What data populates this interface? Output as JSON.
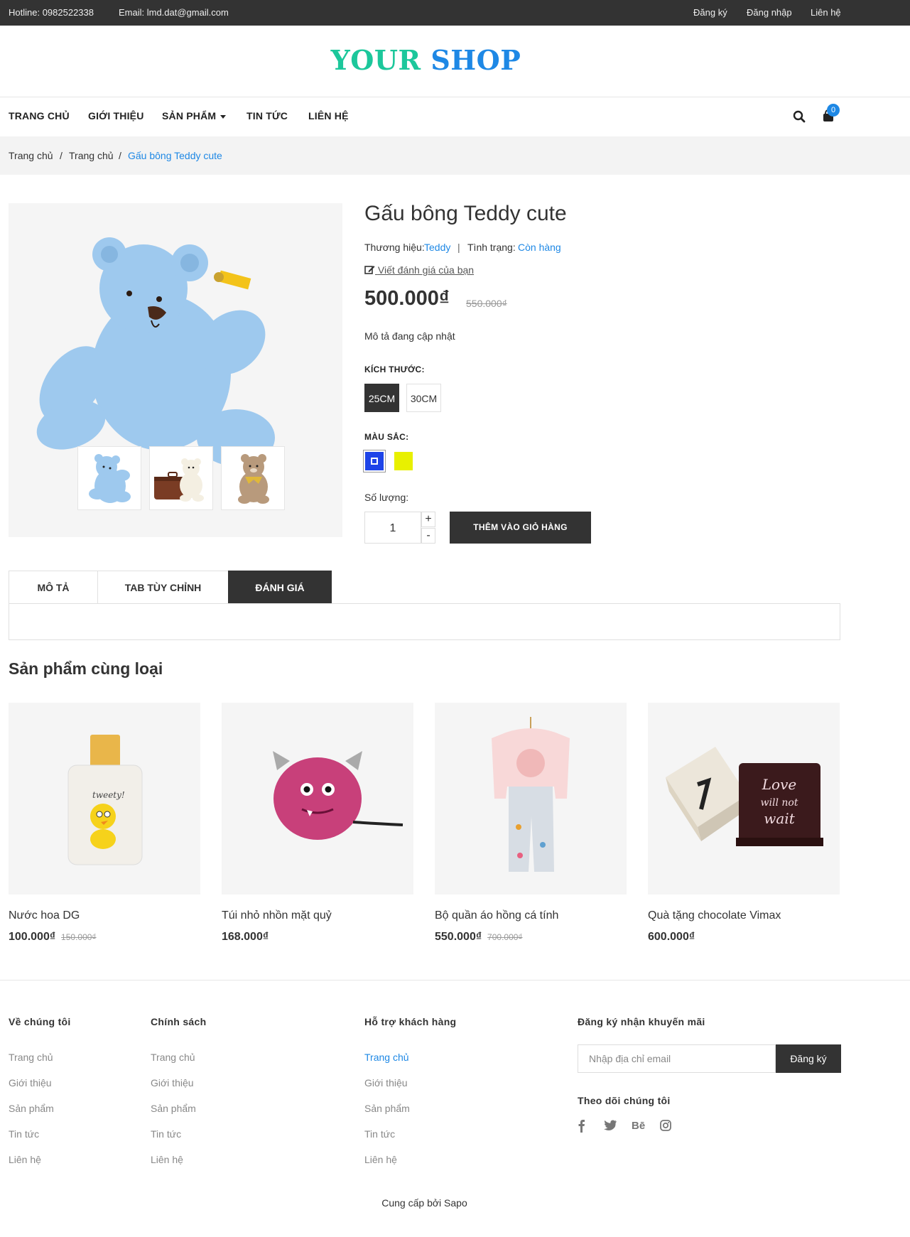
{
  "topbar": {
    "hotline": "Hotline: 0982522338",
    "email": "Email: lmd.dat@gmail.com",
    "register": "Đăng ký",
    "login": "Đăng nhập",
    "contact": "Liên hệ"
  },
  "logo": {
    "word1": "YOUR",
    "word2": "SHOP"
  },
  "nav": {
    "home": "TRANG CHỦ",
    "about": "GIỚI THIỆU",
    "products": "SẢN PHẨM",
    "news": "TIN TỨC",
    "contact": "LIÊN HỆ",
    "cart_count": "0"
  },
  "breadcrumb": [
    "Trang chủ",
    "Trang chủ",
    "Gấu bông Teddy cute"
  ],
  "product": {
    "title": "Gấu bông Teddy cute",
    "brand_label": "Thương hiệu:",
    "brand": "Teddy",
    "separator": "|",
    "status_label": "Tình trạng:",
    "status": "Còn hàng",
    "review_link": "Viết đánh giá của bạn",
    "price": "500.000₫",
    "old_price": "550.000₫",
    "description": "Mô tả đang cập nhật",
    "size_label": "KÍCH THƯỚC:",
    "sizes": [
      "25CM",
      "30CM"
    ],
    "color_label": "MÀU SẮC:",
    "colors": [
      "#1e44e8",
      "#e8f000"
    ],
    "qty_label": "Số lượng:",
    "qty": "1",
    "plus": "+",
    "minus": "-",
    "add_to_cart": "THÊM VÀO GIỎ HÀNG"
  },
  "tabs": [
    "MÔ TẢ",
    "TAB TÙY CHỈNH",
    "ĐÁNH GIÁ"
  ],
  "related": {
    "title": "Sản phẩm cùng loại",
    "items": [
      {
        "name": "Nước hoa DG",
        "price": "100.000₫",
        "old_price": "150.000₫"
      },
      {
        "name": "Túi nhỏ nhồn mặt quỷ",
        "price": "168.000₫",
        "old_price": ""
      },
      {
        "name": "Bộ quần áo hồng cá tính",
        "price": "550.000₫",
        "old_price": "700.000₫"
      },
      {
        "name": "Quà tặng chocolate Vimax",
        "price": "600.000₫",
        "old_price": ""
      }
    ]
  },
  "footer": {
    "col1": {
      "title": "Về chúng tôi",
      "links": [
        "Trang chủ",
        "Giới thiệu",
        "Sản phẩm",
        "Tin tức",
        "Liên hệ"
      ]
    },
    "col2": {
      "title": "Chính sách",
      "links": [
        "Trang chủ",
        "Giới thiệu",
        "Sản phẩm",
        "Tin tức",
        "Liên hệ"
      ]
    },
    "col3": {
      "title": "Hỗ trợ khách hàng",
      "links": [
        "Trang chủ",
        "Giới thiệu",
        "Sản phẩm",
        "Tin tức",
        "Liên hệ"
      ]
    },
    "newsletter_title": "Đăng ký nhận khuyến mãi",
    "email_placeholder": "Nhập địa chỉ email",
    "subscribe": "Đăng ký",
    "follow_title": "Theo dõi chúng tôi",
    "social": [
      "f",
      "t",
      "Bē",
      "ig"
    ],
    "powered": "Cung cấp bởi Sapo"
  }
}
